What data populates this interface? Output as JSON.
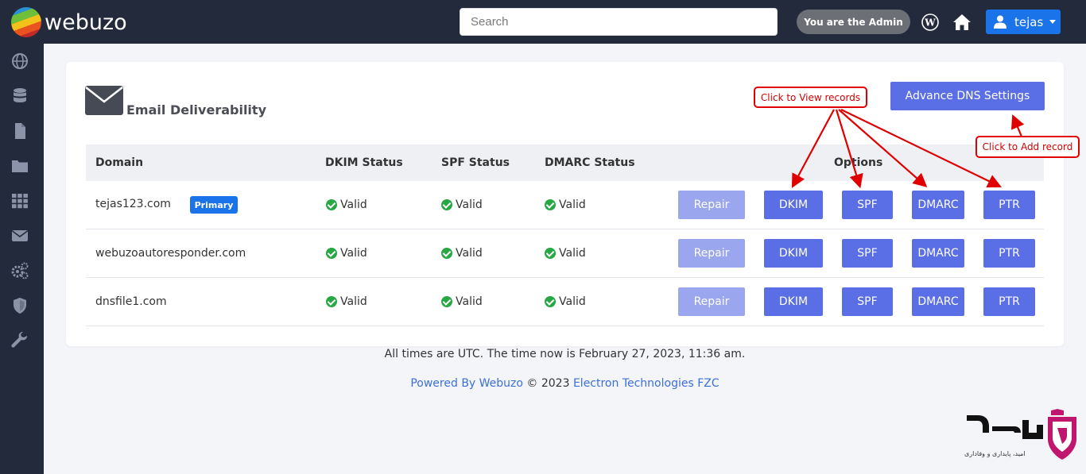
{
  "app": {
    "logo_text": "webuzo"
  },
  "header": {
    "search_placeholder": "Search",
    "admin_label": "You are the Admin",
    "user_name": "tejas",
    "icons": [
      "wordpress-icon",
      "home-icon",
      "user-icon"
    ]
  },
  "sidebar": {
    "icons": [
      "globe-icon",
      "database-icon",
      "file-icon",
      "folder-icon",
      "apps-grid-icon",
      "mail-icon",
      "gears-icon",
      "shield-icon",
      "wrench-icon"
    ]
  },
  "page": {
    "title": "Email Deliverability",
    "advance_button": "Advance DNS Settings"
  },
  "callouts": {
    "view_records": "Click to View records",
    "add_record": "Click to Add record"
  },
  "table": {
    "headers": {
      "domain": "Domain",
      "dkim": "DKIM Status",
      "spf": "SPF Status",
      "dmarc": "DMARC Status",
      "options": "Options"
    },
    "rows": [
      {
        "domain": "tejas123.com",
        "badge": "Primary",
        "dkim": "Valid",
        "spf": "Valid",
        "dmarc": "Valid"
      },
      {
        "domain": "webuzoautoresponder.com",
        "dkim": "Valid",
        "spf": "Valid",
        "dmarc": "Valid"
      },
      {
        "domain": "dnsfile1.com",
        "dkim": "Valid",
        "spf": "Valid",
        "dmarc": "Valid"
      }
    ],
    "buttons": {
      "repair": "Repair",
      "dkim": "DKIM",
      "spf": "SPF",
      "dmarc": "DMARC",
      "ptr": "PTR"
    }
  },
  "footer": {
    "time_notice": "All times are UTC. The time now is February 27, 2023, 11:36 am.",
    "powered_link": "Powered By Webuzo",
    "copyright": " © 2023 ",
    "company_link": "Electron Technologies FZC"
  },
  "watermark": {
    "tagline": "امید، پایداری و وفاداری"
  },
  "colors": {
    "topbar": "#232a3b",
    "accent": "#5a6ee6",
    "primary_blue": "#1a73e8",
    "valid_green": "#28a745",
    "callout_red": "#e00000"
  }
}
